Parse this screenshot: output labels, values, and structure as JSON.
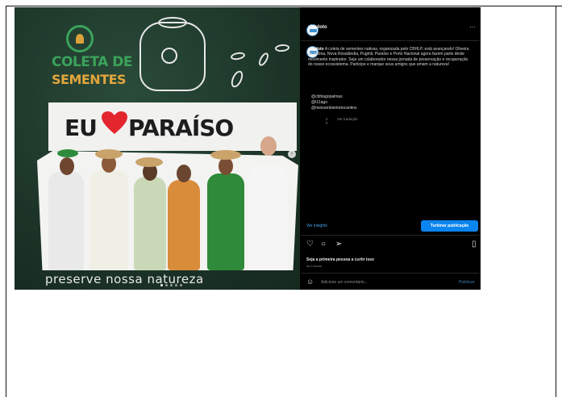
{
  "post": {
    "username": "cbhdoto",
    "caption": "A coleta de sementes nativas, organizada pelo CBHLP, está avançando! Oliveira de Nilóna, Nova Rosalândia, Pugmil, Paraíso e Porto Nacional agora fazem parte deste movimento inspirador. Seja um colaborador nessa jornada de preservação e recuperação do nosso ecossistema. Participe e marque seus amigos que amam a natureza!",
    "mentions": [
      "@cbhlagopalmas",
      "@t11ago",
      "@meioambientetocantins"
    ],
    "meta_time": "4 h",
    "meta_translation": "Ver tradução",
    "more_icon_glyph": "···"
  },
  "image": {
    "logo_line1": "COLETA DE",
    "logo_line2": "SEMENTES",
    "banner_left": "EU",
    "banner_right": "PARAÍSO",
    "footer": "preserve nossa natureza",
    "slide_count": 5,
    "active_slide": 1
  },
  "actions": {
    "insights_label": "Ver insights",
    "boost_label": "Turbinar publicação",
    "like_icon": "heart-icon",
    "comment_icon": "comment-icon",
    "share_icon": "share-icon",
    "save_icon": "bookmark-icon",
    "likes_text": "Seja a primeira pessoa a curtir isso",
    "date_text": "há 4 horas",
    "comment_placeholder": "Adicione um comentário...",
    "post_label": "Publicar"
  },
  "colors": {
    "accent_blue": "#0a84ee",
    "brand_green": "#3aa35a",
    "brand_orange": "#e2a63c",
    "heart_red": "#e3262e"
  }
}
